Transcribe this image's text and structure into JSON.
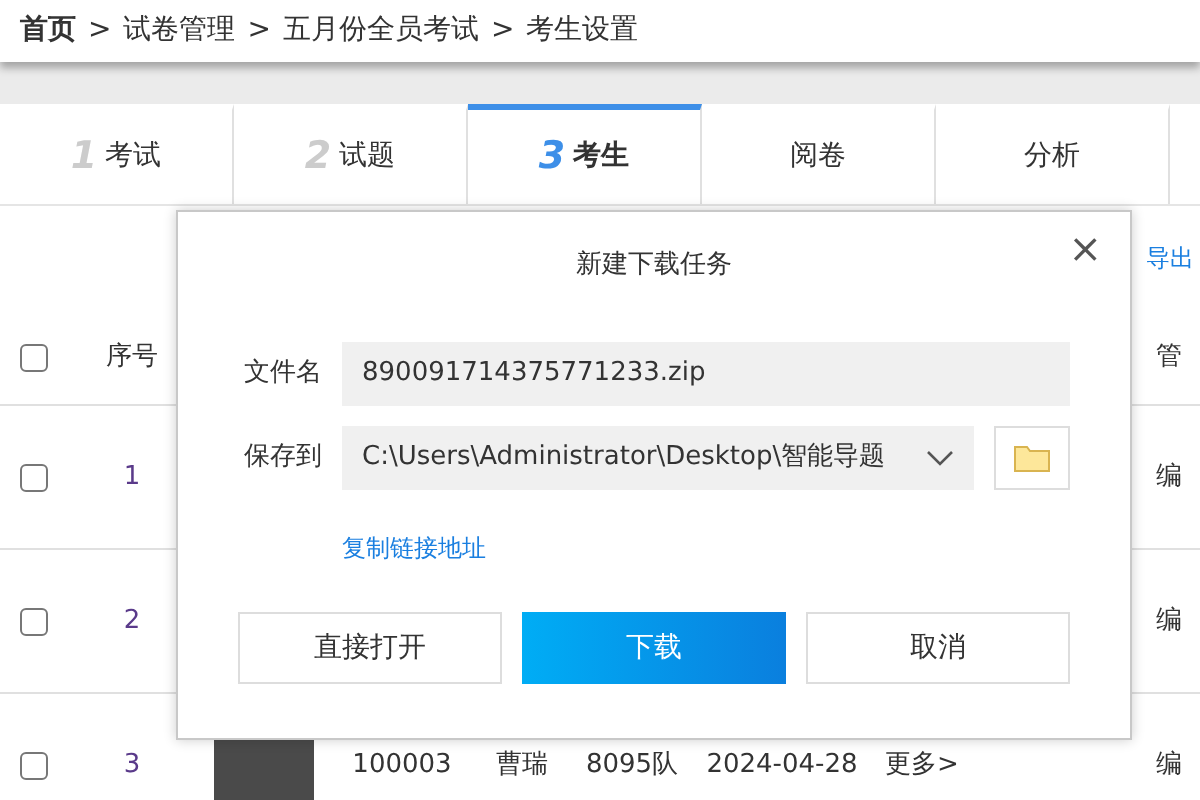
{
  "breadcrumb": [
    {
      "label": "首页",
      "bold": true
    },
    {
      "label": "试卷管理",
      "bold": false
    },
    {
      "label": "五月份全员考试",
      "bold": false
    },
    {
      "label": "考生设置",
      "bold": false
    }
  ],
  "breadcrumb_separator": ">",
  "tabs": [
    {
      "number": "1",
      "label": "考试",
      "selected": false
    },
    {
      "number": "2",
      "label": "试题",
      "selected": false
    },
    {
      "number": "3",
      "label": "考生",
      "selected": true
    },
    {
      "label": "阅卷",
      "selected": false
    },
    {
      "label": "分析",
      "selected": false
    }
  ],
  "toolbar": {
    "export_link": "导出"
  },
  "table": {
    "columns": [
      "序号",
      "管"
    ],
    "select_all_checked": false,
    "rows": [
      {
        "checked": false,
        "index": "1",
        "action": "编"
      },
      {
        "checked": false,
        "index": "2",
        "action": "编"
      },
      {
        "checked": false,
        "index": "3",
        "id": "100003",
        "name": "曹瑞",
        "team": "8095队",
        "date": "2024-04-28",
        "more": "更多>",
        "action": "编"
      }
    ]
  },
  "dialog": {
    "title": "新建下载任务",
    "close": "×",
    "filename_label": "文件名",
    "filename": "890091714375771233.zip",
    "save_label": "保存到",
    "save_path": "C:\\Users\\Administrator\\Desktop\\智能导题",
    "copy_link": "复制链接地址",
    "buttons": [
      {
        "label": "直接打开",
        "kind": "plain"
      },
      {
        "label": "下载",
        "kind": "primary"
      },
      {
        "label": "取消",
        "kind": "plain"
      }
    ]
  }
}
